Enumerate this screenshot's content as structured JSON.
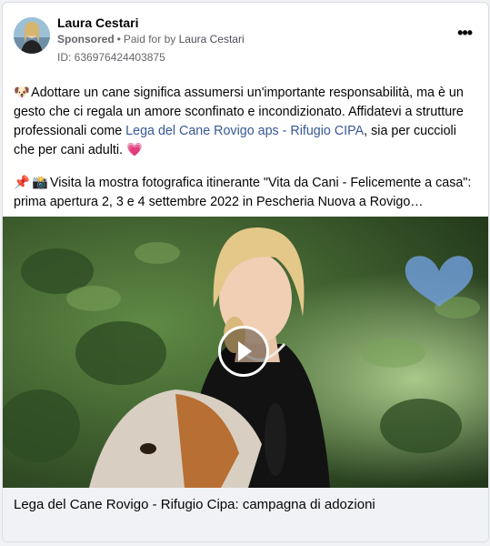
{
  "post": {
    "author": "Laura Cestari",
    "sponsored_label": "Sponsored",
    "separator": "•",
    "paid_for_prefix": "Paid for by",
    "paid_for_name": "Laura Cestari",
    "id_line": "ID: 636976424403875",
    "more_glyph": "•••",
    "paragraph1": {
      "emoji": "🐶",
      "text_before_link": " Adottare un cane significa assumersi un'importante responsabilità, ma è un gesto che ci regala un amore sconfinato e incondizionato. Affidatevi a strutture professionali come ",
      "link": "Lega del Cane Rovigo aps - Rifugio CIPA",
      "text_after_link": ", sia per cuccioli che per cani adulti. ",
      "end_emoji": "💗"
    },
    "paragraph2": {
      "emoji1": "📌",
      "emoji2": "📸",
      "text": " Visita la mostra fotografica itinerante \"Vita da Cani - Felicemente a casa\": prima apertura 2, 3 e 4 settembre 2022 in Pescheria Nuova a Rovigo…"
    },
    "video_caption": "Lega del Cane Rovigo - Rifugio Cipa: campagna di adozioni"
  },
  "colors": {
    "link": "#385898",
    "meta": "#65676b",
    "caption_bg": "#f0f2f5",
    "heart_badge": "#6f9bd6"
  },
  "icons": {
    "play": "play-icon",
    "heart_logo": "heart-logo-icon",
    "more": "more-options-icon"
  }
}
